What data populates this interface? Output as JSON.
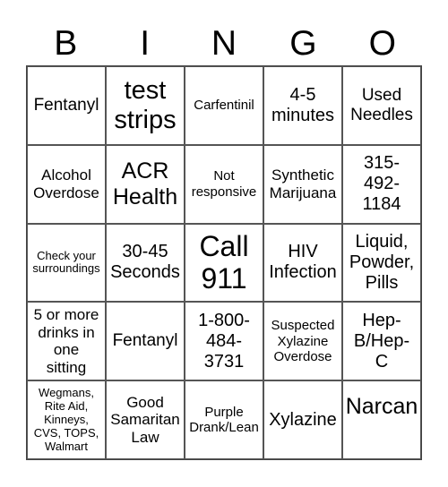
{
  "header": {
    "letters": [
      "B",
      "I",
      "N",
      "G",
      "O"
    ]
  },
  "cells": [
    "Fentanyl",
    "test strips",
    "Carfentinil",
    "4-5 minutes",
    "Used Needles",
    "Alcohol Overdose",
    "ACR Health",
    "Not responsive",
    "Synthetic Marijuana",
    "315-492-1184",
    "Check your surroundings",
    "30-45 Seconds",
    "Call 911",
    "HIV Infection",
    "Liquid, Powder, Pills",
    "5 or more drinks in one sitting",
    "Fentanyl",
    "1-800-484-3731",
    "Suspected Xylazine Overdose",
    "Hep-B/Hep-C",
    "Wegmans, Rite Aid, Kinneys, CVS, TOPS, Walmart",
    "Good Samaritan Law",
    "Purple Drank/Lean",
    "Xylazine",
    "Narcan"
  ]
}
